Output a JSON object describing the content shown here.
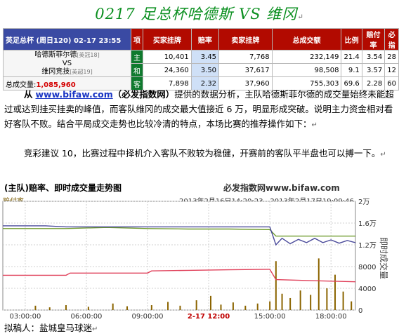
{
  "title": "0217 足总杯哈德斯 VS 维冈",
  "para_mark": "↵",
  "table": {
    "match_info": "英足总杯 (周日120) 02-17 23:55",
    "headers": [
      "项",
      "买家挂牌",
      "赔率",
      "卖家挂牌",
      "总成交额",
      "比例",
      "赔付率",
      "必指"
    ],
    "home_team": "哈德斯菲尔德",
    "home_rank": "[英冠18]",
    "vs": "VS",
    "away_team": "维冈竞技",
    "away_rank": "[英超19]",
    "volume_label": "总成交量:",
    "volume_value": "1,085,960",
    "rows": [
      {
        "label": "主",
        "buy": "10,401",
        "odds": "3.45",
        "sell": "7,768",
        "total": "232,149",
        "ratio": "21.4",
        "payout": "3.54",
        "index": "28"
      },
      {
        "label": "和",
        "buy": "24,360",
        "odds": "3.50",
        "sell": "37,617",
        "total": "98,508",
        "ratio": "9.1",
        "payout": "3.57",
        "index": "12"
      },
      {
        "label": "客",
        "buy": "7,898",
        "odds": "2.32",
        "sell": "37,960",
        "total": "755,303",
        "ratio": "69.6",
        "payout": "2.28",
        "index": "60"
      }
    ]
  },
  "paragraph1": {
    "prefix": "从",
    "link": "www.bifaw.com",
    "brand": "（必发指数网）",
    "text": "提供的数据分析，主队哈德斯菲尔德的成交量始终未能超过或达到挂买挂卖的峰值，而客队维冈的成交最大值接近 6 万，明显形成突破。说明主力资金相对看好客队不败。结合平局成交走势也比较冷清的特点，本场比赛的推荐操作如下："
  },
  "paragraph2": "竞彩建议 10，比赛过程中择机介入客队不败较为稳健，开赛前的客队平半盘也可以搏一下。",
  "chart_header": {
    "title": "(主队)赔率、即时成交量走势图",
    "brand": "必发指数网www.bifaw.com",
    "series_label": "赔付率",
    "range": "2013年2月16日14:20:23 - 2013年2月17日19:09:46",
    "right_axis_label": "即时成交量"
  },
  "chart_data": {
    "type": "line",
    "x_tick_labels": [
      "03:00:00",
      "06:00:00",
      "09:00:00",
      "2-17 12:00",
      "15:00:00",
      "18:00:00"
    ],
    "x_ticks": [
      0,
      3,
      6,
      9,
      12,
      15
    ],
    "xlim": [
      -1.1,
      16.2
    ],
    "y_tick_labels": [
      "2万",
      "1.6万",
      "1.2万",
      "8000",
      "4000",
      "0"
    ],
    "y_ticks": [
      20000,
      16000,
      12000,
      8000,
      4000,
      0
    ],
    "ylim": [
      0,
      20000
    ],
    "series": [
      {
        "color": "#6e9a2a",
        "x": [
          -1.1,
          2,
          4,
          6,
          8,
          10,
          12,
          12.3,
          14,
          16.2
        ],
        "y": [
          15000,
          15000,
          15200,
          15000,
          14900,
          14900,
          14800,
          13600,
          13600,
          13600
        ]
      },
      {
        "color": "#4a4a9a",
        "x": [
          -1.1,
          1,
          2,
          4,
          6,
          8,
          10,
          11.6,
          12,
          12.3,
          12.6,
          13,
          13.4,
          13.8,
          14.2,
          14.6,
          15,
          15.4,
          15.8,
          16.2
        ],
        "y": [
          15500,
          15500,
          15300,
          15300,
          15300,
          15300,
          15300,
          15300,
          15300,
          12000,
          13200,
          12200,
          13000,
          12400,
          13200,
          12400,
          12900,
          12300,
          12800,
          12400
        ]
      },
      {
        "color": "#e0405a",
        "x": [
          -1.1,
          2,
          2.2,
          4,
          6,
          6.2,
          8,
          10,
          12,
          12.3,
          14,
          16.2
        ],
        "y": [
          6400,
          6400,
          6800,
          6800,
          6800,
          7200,
          7300,
          7400,
          7500,
          5600,
          5400,
          5200
        ]
      }
    ],
    "volume_bars_color": "#8b6400",
    "volume_bars": [
      {
        "x": 0.5,
        "y": 800
      },
      {
        "x": 1.2,
        "y": 500
      },
      {
        "x": 2.0,
        "y": 900
      },
      {
        "x": 3.1,
        "y": 600
      },
      {
        "x": 4.3,
        "y": 1200
      },
      {
        "x": 5.0,
        "y": 700
      },
      {
        "x": 6.2,
        "y": 900
      },
      {
        "x": 7.0,
        "y": 1500
      },
      {
        "x": 7.6,
        "y": 800
      },
      {
        "x": 8.4,
        "y": 1800
      },
      {
        "x": 9.1,
        "y": 2600
      },
      {
        "x": 9.6,
        "y": 1000
      },
      {
        "x": 10.2,
        "y": 1400
      },
      {
        "x": 10.8,
        "y": 800
      },
      {
        "x": 11.4,
        "y": 1200
      },
      {
        "x": 12.0,
        "y": 1600
      },
      {
        "x": 12.3,
        "y": 9000
      },
      {
        "x": 12.6,
        "y": 3000
      },
      {
        "x": 13.0,
        "y": 2200
      },
      {
        "x": 13.5,
        "y": 3600
      },
      {
        "x": 14.0,
        "y": 2800
      },
      {
        "x": 14.4,
        "y": 9500
      },
      {
        "x": 14.8,
        "y": 4000
      },
      {
        "x": 15.2,
        "y": 6500
      },
      {
        "x": 15.6,
        "y": 3400
      },
      {
        "x": 16.0,
        "y": 1600
      }
    ],
    "grid": true
  },
  "footer": "拟稿人：盐城皇马球迷"
}
